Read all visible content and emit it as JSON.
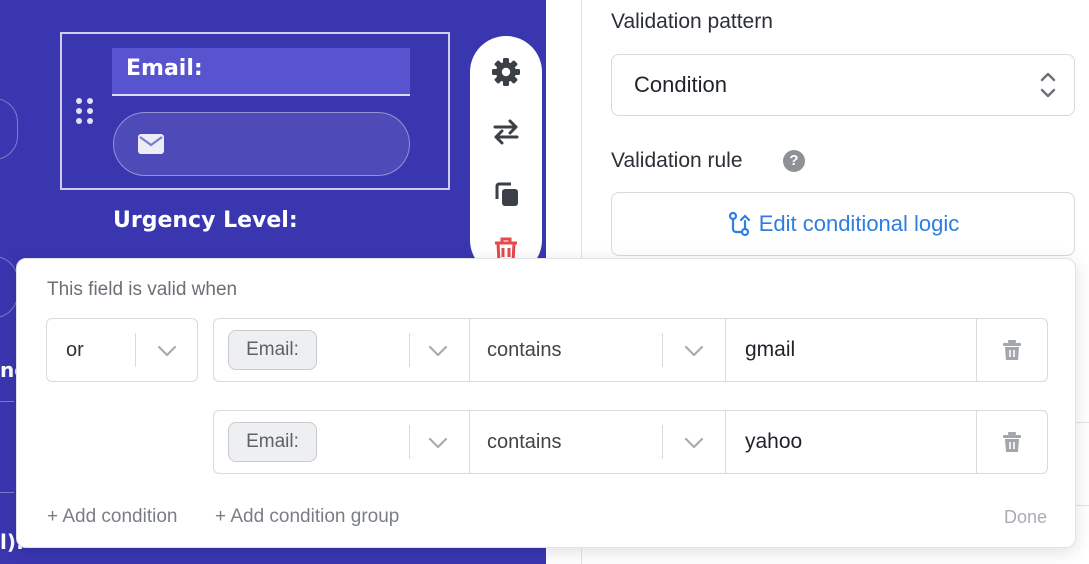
{
  "canvas": {
    "email_label": "Email:",
    "urgency_label": "Urgency Level:",
    "cut_text_1": "ne",
    "cut_text_2": "l):",
    "tools": [
      "gear-icon",
      "swap-icon",
      "duplicate-icon",
      "trash-icon"
    ]
  },
  "panel": {
    "validation_pattern_label": "Validation pattern",
    "validation_pattern_value": "Condition",
    "validation_rule_label": "Validation rule",
    "help_icon": "?",
    "edit_logic_label": "Edit conditional logic"
  },
  "popover": {
    "title": "This field is valid when",
    "group_operator": "or",
    "conditions": [
      {
        "field": "Email:",
        "operator": "contains",
        "value": "gmail"
      },
      {
        "field": "Email:",
        "operator": "contains",
        "value": "yahoo"
      }
    ],
    "add_condition": "+ Add condition",
    "add_condition_group": "+ Add condition group",
    "done": "Done"
  },
  "colors": {
    "canvas_bg": "#3a36b0",
    "accent_blue": "#2f7de1",
    "delete_red": "#e5484d"
  }
}
